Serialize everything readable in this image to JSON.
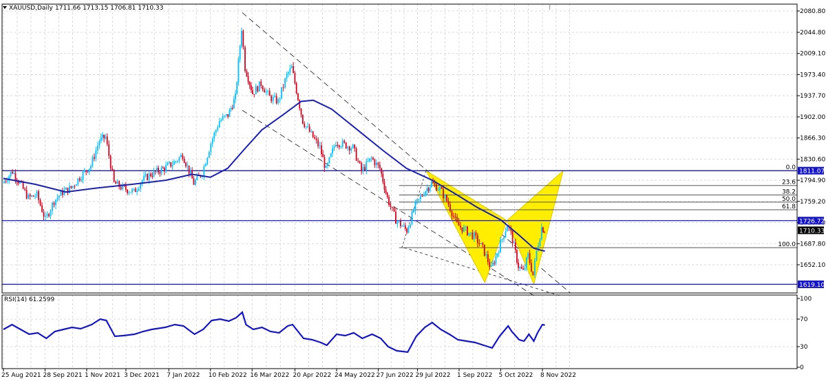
{
  "header": {
    "symbol": "XAUUSD,Daily",
    "ohlc": "1711.66 1713.15 1706.81 1710.33"
  },
  "chart_data": [
    {
      "type": "candlestick",
      "symbol": "XAUUSD",
      "timeframe": "Daily",
      "last": {
        "open": 1711.66,
        "high": 1713.15,
        "low": 1706.81,
        "close": 1710.33
      },
      "y_ticks": [
        2080.8,
        2044.8,
        2009.1,
        1973.4,
        1937.7,
        1902.0,
        1866.3,
        1830.6,
        1794.9,
        1759.2,
        1723.5,
        1687.8,
        1652.1
      ],
      "y_tick_labels": [
        "2080.80",
        "2044.80",
        "2009.10",
        "1973.40",
        "1937.70",
        "1902.00",
        "1866.30",
        "1830.60",
        "1794.90",
        "1759.20",
        "1723.50",
        "1687.80",
        "1652.10"
      ],
      "ylim": [
        1608,
        2088
      ],
      "x_tick_labels": [
        "25 Aug 2021",
        "28 Sep 2021",
        "1 Nov 2021",
        "3 Dec 2021",
        "7 Jan 2022",
        "10 Feb 2022",
        "16 Mar 2022",
        "20 Apr 2022",
        "24 May 2022",
        "27 Jun 2022",
        "29 Jul 2022",
        "1 Sep 2022",
        "5 Oct 2022",
        "8 Nov 2022"
      ],
      "close_path": [
        {
          "date": "2021-08-25",
          "close": 1790
        },
        {
          "date": "2021-09-02",
          "close": 1810
        },
        {
          "date": "2021-09-08",
          "close": 1790
        },
        {
          "date": "2021-09-15",
          "close": 1765
        },
        {
          "date": "2021-09-22",
          "close": 1770
        },
        {
          "date": "2021-09-29",
          "close": 1728
        },
        {
          "date": "2021-10-06",
          "close": 1760
        },
        {
          "date": "2021-10-13",
          "close": 1775
        },
        {
          "date": "2021-10-20",
          "close": 1782
        },
        {
          "date": "2021-10-27",
          "close": 1800
        },
        {
          "date": "2021-11-05",
          "close": 1820
        },
        {
          "date": "2021-11-12",
          "close": 1862
        },
        {
          "date": "2021-11-17",
          "close": 1868
        },
        {
          "date": "2021-11-24",
          "close": 1790
        },
        {
          "date": "2021-12-01",
          "close": 1782
        },
        {
          "date": "2021-12-10",
          "close": 1775
        },
        {
          "date": "2021-12-17",
          "close": 1795
        },
        {
          "date": "2021-12-24",
          "close": 1805
        },
        {
          "date": "2022-01-04",
          "close": 1815
        },
        {
          "date": "2022-01-12",
          "close": 1825
        },
        {
          "date": "2022-01-19",
          "close": 1838
        },
        {
          "date": "2022-01-28",
          "close": 1790
        },
        {
          "date": "2022-02-04",
          "close": 1808
        },
        {
          "date": "2022-02-11",
          "close": 1858
        },
        {
          "date": "2022-02-18",
          "close": 1895
        },
        {
          "date": "2022-02-25",
          "close": 1905
        },
        {
          "date": "2022-03-03",
          "close": 1935
        },
        {
          "date": "2022-03-08",
          "close": 2052
        },
        {
          "date": "2022-03-11",
          "close": 1985
        },
        {
          "date": "2022-03-17",
          "close": 1942
        },
        {
          "date": "2022-03-24",
          "close": 1958
        },
        {
          "date": "2022-03-31",
          "close": 1935
        },
        {
          "date": "2022-04-07",
          "close": 1928
        },
        {
          "date": "2022-04-14",
          "close": 1972
        },
        {
          "date": "2022-04-18",
          "close": 1985
        },
        {
          "date": "2022-04-27",
          "close": 1895
        },
        {
          "date": "2022-05-04",
          "close": 1872
        },
        {
          "date": "2022-05-11",
          "close": 1850
        },
        {
          "date": "2022-05-16",
          "close": 1812
        },
        {
          "date": "2022-05-24",
          "close": 1860
        },
        {
          "date": "2022-05-31",
          "close": 1855
        },
        {
          "date": "2022-06-07",
          "close": 1850
        },
        {
          "date": "2022-06-14",
          "close": 1810
        },
        {
          "date": "2022-06-22",
          "close": 1832
        },
        {
          "date": "2022-06-29",
          "close": 1815
        },
        {
          "date": "2022-07-05",
          "close": 1765
        },
        {
          "date": "2022-07-12",
          "close": 1728
        },
        {
          "date": "2022-07-21",
          "close": 1710
        },
        {
          "date": "2022-07-28",
          "close": 1752
        },
        {
          "date": "2022-08-04",
          "close": 1775
        },
        {
          "date": "2022-08-10",
          "close": 1790
        },
        {
          "date": "2022-08-17",
          "close": 1780
        },
        {
          "date": "2022-08-24",
          "close": 1755
        },
        {
          "date": "2022-08-31",
          "close": 1720
        },
        {
          "date": "2022-09-07",
          "close": 1710
        },
        {
          "date": "2022-09-14",
          "close": 1700
        },
        {
          "date": "2022-09-21",
          "close": 1680
        },
        {
          "date": "2022-09-28",
          "close": 1645
        },
        {
          "date": "2022-10-04",
          "close": 1680
        },
        {
          "date": "2022-10-11",
          "close": 1720
        },
        {
          "date": "2022-10-14",
          "close": 1705
        },
        {
          "date": "2022-10-20",
          "close": 1650
        },
        {
          "date": "2022-10-24",
          "close": 1640
        },
        {
          "date": "2022-10-28",
          "close": 1668
        },
        {
          "date": "2022-11-01",
          "close": 1635
        },
        {
          "date": "2022-11-04",
          "close": 1675
        },
        {
          "date": "2022-11-08",
          "close": 1715
        },
        {
          "date": "2022-11-10",
          "close": 1710.33
        }
      ],
      "moving_average": [
        {
          "date": "2021-08-25",
          "value": 1798
        },
        {
          "date": "2021-09-20",
          "value": 1788
        },
        {
          "date": "2021-10-15",
          "value": 1775
        },
        {
          "date": "2021-11-10",
          "value": 1782
        },
        {
          "date": "2021-12-08",
          "value": 1788
        },
        {
          "date": "2022-01-05",
          "value": 1795
        },
        {
          "date": "2022-01-26",
          "value": 1805
        },
        {
          "date": "2022-02-10",
          "value": 1800
        },
        {
          "date": "2022-02-24",
          "value": 1815
        },
        {
          "date": "2022-03-10",
          "value": 1848
        },
        {
          "date": "2022-03-24",
          "value": 1880
        },
        {
          "date": "2022-04-10",
          "value": 1905
        },
        {
          "date": "2022-04-25",
          "value": 1928
        },
        {
          "date": "2022-05-05",
          "value": 1930
        },
        {
          "date": "2022-05-20",
          "value": 1915
        },
        {
          "date": "2022-06-10",
          "value": 1880
        },
        {
          "date": "2022-07-01",
          "value": 1845
        },
        {
          "date": "2022-07-20",
          "value": 1815
        },
        {
          "date": "2022-08-10",
          "value": 1795
        },
        {
          "date": "2022-08-28",
          "value": 1773
        },
        {
          "date": "2022-09-15",
          "value": 1750
        },
        {
          "date": "2022-10-05",
          "value": 1728
        },
        {
          "date": "2022-10-20",
          "value": 1702
        },
        {
          "date": "2022-11-01",
          "value": 1680
        },
        {
          "date": "2022-11-10",
          "value": 1675
        }
      ],
      "horizontal_levels": [
        {
          "value": 1811.07,
          "label": "1811.07"
        },
        {
          "value": 1726.72,
          "label": "1726.72"
        },
        {
          "value": 1619.1,
          "label": "1619.10"
        }
      ],
      "current_price_label": "1710.33",
      "fibonacci": {
        "levels": [
          {
            "ratio_label": "0.0",
            "value": 1811.07
          },
          {
            "ratio_label": "23.6",
            "value": 1786
          },
          {
            "ratio_label": "38.2",
            "value": 1770
          },
          {
            "ratio_label": "50.0",
            "value": 1758
          },
          {
            "ratio_label": "61.8",
            "value": 1745
          },
          {
            "ratio_label": "100.0",
            "value": 1681
          }
        ]
      },
      "channel": {
        "upper": [
          {
            "date": "2022-03-08",
            "price": 2078
          },
          {
            "date": "2022-12-01",
            "price": 1604
          }
        ],
        "lower": [
          {
            "date": "2022-03-08",
            "price": 1913
          },
          {
            "date": "2022-11-01",
            "price": 1600
          }
        ]
      },
      "harmonic_pattern": {
        "points": [
          {
            "date": "2022-08-05",
            "price": 1811.07
          },
          {
            "date": "2022-09-22",
            "price": 1622
          },
          {
            "date": "2022-10-10",
            "price": 1726.72
          },
          {
            "date": "2022-11-01",
            "price": 1619.1
          },
          {
            "date": "2022-11-25",
            "price": 1811.07
          }
        ],
        "color": "#ffee00"
      },
      "colors": {
        "up": "#00bfff",
        "down": "#d6001c",
        "ma": "#1a1fb5",
        "levels": "#1414c8"
      }
    },
    {
      "type": "line",
      "indicator": "RSI(14)",
      "label": "RSI(14) 61.2599",
      "value": 61.2599,
      "y_ticks": [
        100,
        70,
        30,
        0
      ],
      "ylim": [
        0,
        100
      ],
      "series": [
        {
          "date": "2021-08-25",
          "value": 55
        },
        {
          "date": "2021-09-01",
          "value": 62
        },
        {
          "date": "2021-09-08",
          "value": 55
        },
        {
          "date": "2021-09-15",
          "value": 48
        },
        {
          "date": "2021-09-22",
          "value": 50
        },
        {
          "date": "2021-09-29",
          "value": 42
        },
        {
          "date": "2021-10-06",
          "value": 52
        },
        {
          "date": "2021-10-13",
          "value": 55
        },
        {
          "date": "2021-10-20",
          "value": 58
        },
        {
          "date": "2021-10-27",
          "value": 56
        },
        {
          "date": "2021-11-05",
          "value": 62
        },
        {
          "date": "2021-11-12",
          "value": 70
        },
        {
          "date": "2021-11-17",
          "value": 68
        },
        {
          "date": "2021-11-24",
          "value": 45
        },
        {
          "date": "2021-12-01",
          "value": 46
        },
        {
          "date": "2021-12-10",
          "value": 48
        },
        {
          "date": "2021-12-17",
          "value": 52
        },
        {
          "date": "2021-12-24",
          "value": 55
        },
        {
          "date": "2022-01-04",
          "value": 58
        },
        {
          "date": "2022-01-12",
          "value": 62
        },
        {
          "date": "2022-01-19",
          "value": 60
        },
        {
          "date": "2022-01-28",
          "value": 48
        },
        {
          "date": "2022-02-04",
          "value": 55
        },
        {
          "date": "2022-02-11",
          "value": 68
        },
        {
          "date": "2022-02-18",
          "value": 70
        },
        {
          "date": "2022-02-25",
          "value": 67
        },
        {
          "date": "2022-03-03",
          "value": 72
        },
        {
          "date": "2022-03-08",
          "value": 80
        },
        {
          "date": "2022-03-11",
          "value": 62
        },
        {
          "date": "2022-03-17",
          "value": 55
        },
        {
          "date": "2022-03-24",
          "value": 58
        },
        {
          "date": "2022-03-31",
          "value": 52
        },
        {
          "date": "2022-04-07",
          "value": 50
        },
        {
          "date": "2022-04-14",
          "value": 60
        },
        {
          "date": "2022-04-18",
          "value": 62
        },
        {
          "date": "2022-04-27",
          "value": 42
        },
        {
          "date": "2022-05-04",
          "value": 40
        },
        {
          "date": "2022-05-11",
          "value": 36
        },
        {
          "date": "2022-05-16",
          "value": 32
        },
        {
          "date": "2022-05-24",
          "value": 48
        },
        {
          "date": "2022-05-31",
          "value": 46
        },
        {
          "date": "2022-06-07",
          "value": 50
        },
        {
          "date": "2022-06-14",
          "value": 42
        },
        {
          "date": "2022-06-22",
          "value": 48
        },
        {
          "date": "2022-06-29",
          "value": 42
        },
        {
          "date": "2022-07-05",
          "value": 30
        },
        {
          "date": "2022-07-12",
          "value": 24
        },
        {
          "date": "2022-07-21",
          "value": 22
        },
        {
          "date": "2022-07-28",
          "value": 45
        },
        {
          "date": "2022-08-04",
          "value": 58
        },
        {
          "date": "2022-08-10",
          "value": 65
        },
        {
          "date": "2022-08-17",
          "value": 55
        },
        {
          "date": "2022-08-24",
          "value": 48
        },
        {
          "date": "2022-08-31",
          "value": 40
        },
        {
          "date": "2022-09-07",
          "value": 38
        },
        {
          "date": "2022-09-14",
          "value": 36
        },
        {
          "date": "2022-09-21",
          "value": 32
        },
        {
          "date": "2022-09-28",
          "value": 28
        },
        {
          "date": "2022-10-04",
          "value": 45
        },
        {
          "date": "2022-10-11",
          "value": 60
        },
        {
          "date": "2022-10-14",
          "value": 52
        },
        {
          "date": "2022-10-20",
          "value": 40
        },
        {
          "date": "2022-10-24",
          "value": 38
        },
        {
          "date": "2022-10-28",
          "value": 48
        },
        {
          "date": "2022-11-01",
          "value": 38
        },
        {
          "date": "2022-11-04",
          "value": 50
        },
        {
          "date": "2022-11-08",
          "value": 62
        },
        {
          "date": "2022-11-10",
          "value": 61.26
        }
      ],
      "color": "#1414c8"
    }
  ]
}
